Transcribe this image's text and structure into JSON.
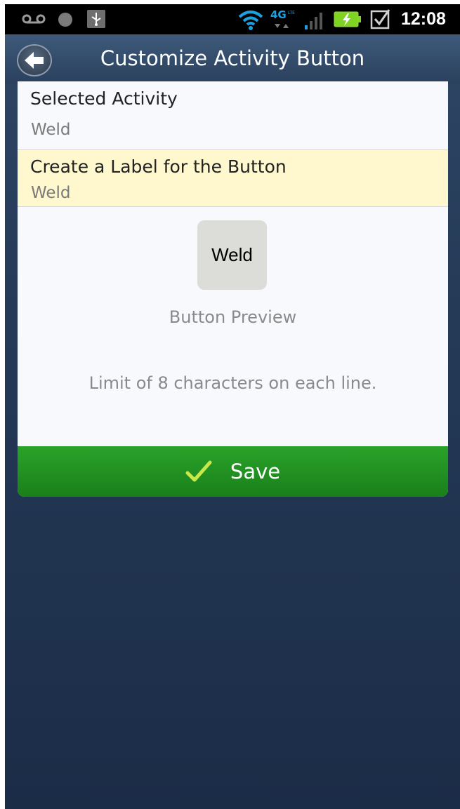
{
  "status_bar": {
    "time": "12:08",
    "icons": [
      "voicemail-icon",
      "notification-dot-icon",
      "usb-icon",
      "wifi-icon",
      "4g-lte-icon",
      "signal-icon",
      "battery-charging-icon",
      "checkbox-notification-icon"
    ],
    "network_label": "4G LTE"
  },
  "header": {
    "title": "Customize Activity Button",
    "back_icon": "back-arrow-icon"
  },
  "selected_activity": {
    "title": "Selected Activity",
    "value": "Weld"
  },
  "label_field": {
    "title": "Create a Label for the Button",
    "value": "Weld"
  },
  "preview": {
    "button_text": "Weld",
    "caption": "Button Preview"
  },
  "limit_note": "Limit of 8 characters on each line.",
  "save": {
    "label": "Save",
    "icon": "checkmark-icon"
  },
  "colors": {
    "accent_green": "#22922a",
    "highlight_row": "#fff8cf",
    "background": "#253b58"
  }
}
